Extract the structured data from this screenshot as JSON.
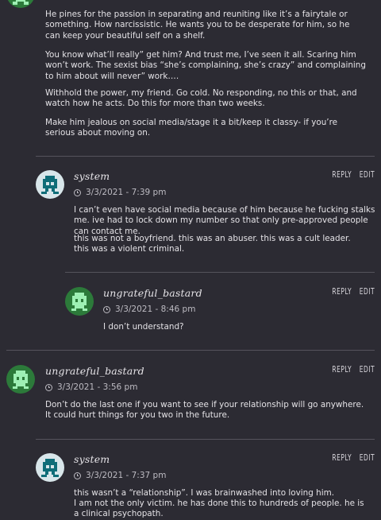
{
  "theme": {
    "background": "#2c2b33",
    "text": "#e4e2e6",
    "divider": "#55535c",
    "avatar_system_bg": "#d8e6ea",
    "avatar_system_fg": "#0f6d78",
    "avatar_ungrateful_bg": "#2c7a3a",
    "avatar_ungrateful_fg": "#9ef0b4"
  },
  "top_post": {
    "paragraphs": [
      "He pines for the passion in separating and reuniting like it’s a fairytale or something. How narcissistic. He wants you to be desperate for him, so he can keep your beautiful self on a shelf.",
      "You know what’ll really” get him? And trust me, I’ve seen it all. Scaring him won’t work. The sexist bias “she’s complaining, she’s crazy” and complaining to him about will never” work….",
      "Withhold the power, my friend. Go cold. No responding, no this or that, and watch how he acts. Do this for more than two weeks.",
      "Make him jealous on social media/stage it a bit/keep it classy- if you’re serious about moving on."
    ]
  },
  "comments": [
    {
      "author": "system",
      "date": "3/3/2021 - 7:39 pm",
      "reply_label": "REPLY",
      "edit_label": "EDIT",
      "paragraphs": [
        "I can’t even have social media because of him because he fucking stalks me. ive had to lock down my number so that only pre-approved people can contact me.",
        "this was not a boyfriend. this was an abuser. this was a cult leader. this was a violent criminal."
      ]
    },
    {
      "author": "ungrateful_bastard",
      "date": "3/3/2021 - 8:46 pm",
      "reply_label": "REPLY",
      "edit_label": "EDIT",
      "paragraphs": [
        "I don’t understand?"
      ]
    },
    {
      "author": "ungrateful_bastard",
      "date": "3/3/2021 - 3:56 pm",
      "reply_label": "REPLY",
      "edit_label": "EDIT",
      "paragraphs": [
        "Don’t do the last one if you want to see if your relationship will go anywhere. It could hurt things for you two in the future."
      ]
    },
    {
      "author": "system",
      "date": "3/3/2021 - 7:37 pm",
      "reply_label": "REPLY",
      "edit_label": "EDIT",
      "paragraphs": [
        "this wasn’t a “relationship”. I was brainwashed into loving him.",
        "I am not the only victim. he has done this to hundreds of people. he is a clinical psychopath."
      ]
    }
  ]
}
